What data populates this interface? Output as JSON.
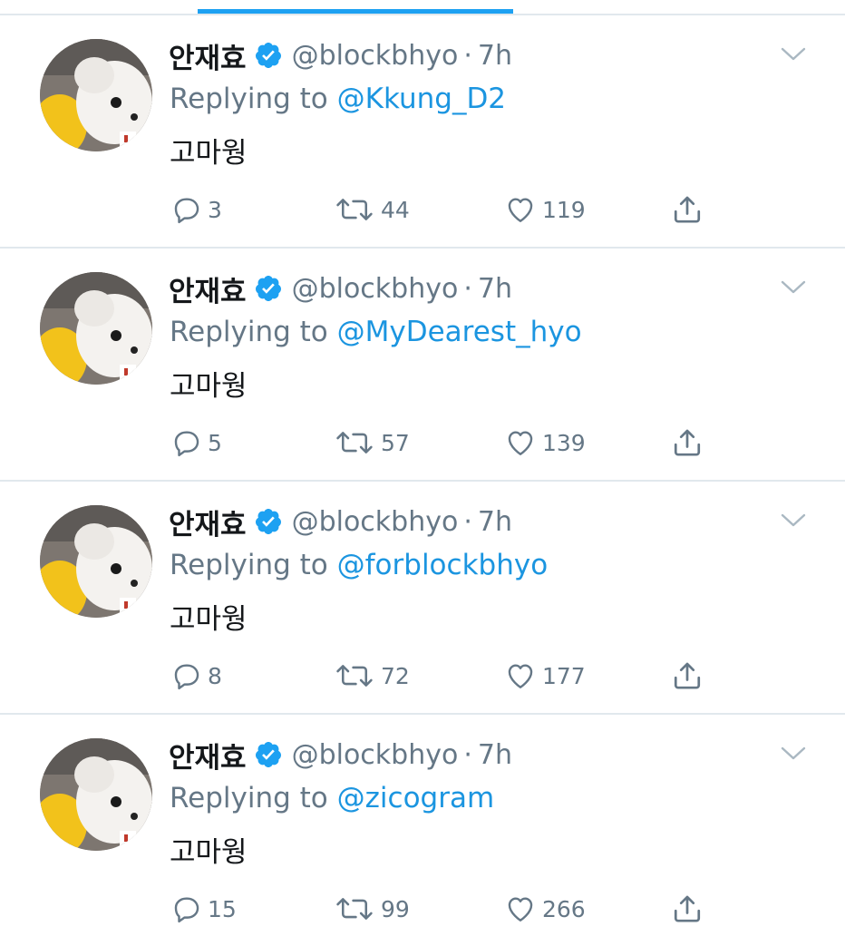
{
  "colors": {
    "accent": "#1da1f2",
    "mention": "#1b95e0",
    "secondary_text": "#657786",
    "primary_text": "#14171a",
    "divider": "#e1e8ed"
  },
  "icons": {
    "verified": "verified-badge-icon",
    "menu": "chevron-down-icon",
    "reply": "reply-bubble-icon",
    "retweet": "retweet-icon",
    "like": "heart-icon",
    "share": "share-icon"
  },
  "tweets": [
    {
      "display_name": "안재효",
      "handle": "@blockbhyo",
      "separator": "·",
      "time": "7h",
      "replying_prefix": "Replying to",
      "replying_to": "@Kkung_D2",
      "text": "고마웡",
      "replies": "3",
      "retweets": "44",
      "likes": "119"
    },
    {
      "display_name": "안재효",
      "handle": "@blockbhyo",
      "separator": "·",
      "time": "7h",
      "replying_prefix": "Replying to",
      "replying_to": "@MyDearest_hyo",
      "text": "고마웡",
      "replies": "5",
      "retweets": "57",
      "likes": "139"
    },
    {
      "display_name": "안재효",
      "handle": "@blockbhyo",
      "separator": "·",
      "time": "7h",
      "replying_prefix": "Replying to",
      "replying_to": "@forblockbhyo",
      "text": "고마웡",
      "replies": "8",
      "retweets": "72",
      "likes": "177"
    },
    {
      "display_name": "안재효",
      "handle": "@blockbhyo",
      "separator": "·",
      "time": "7h",
      "replying_prefix": "Replying to",
      "replying_to": "@zicogram",
      "text": "고마웡",
      "replies": "15",
      "retweets": "99",
      "likes": "266"
    }
  ]
}
